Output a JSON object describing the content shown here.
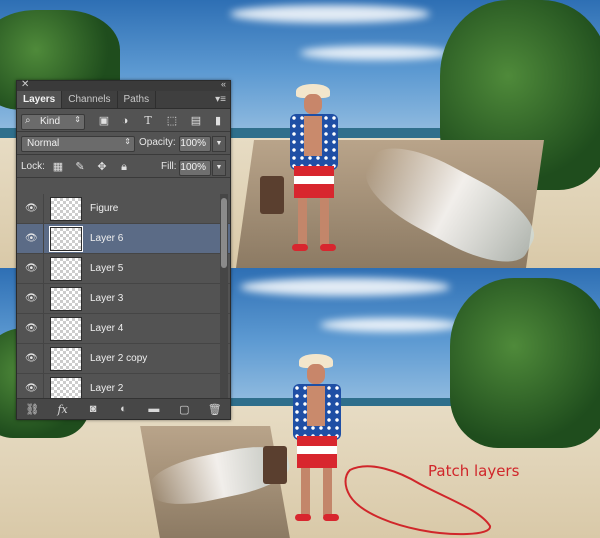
{
  "panel": {
    "close_glyph": "✕",
    "collapse_glyph": "«",
    "tabs": [
      {
        "label": "Layers",
        "active": true
      },
      {
        "label": "Channels",
        "active": false
      },
      {
        "label": "Paths",
        "active": false
      }
    ],
    "menu_glyph": "▾≡",
    "filter": {
      "label": "Kind",
      "icon": "search-icon"
    },
    "filter_icons": [
      "image-filter-icon",
      "adjustment-filter-icon",
      "type-filter-icon",
      "shape-filter-icon",
      "smart-object-filter-icon"
    ],
    "blend_mode": "Normal",
    "opacity_label": "Opacity:",
    "opacity_value": "100%",
    "lock_label": "Lock:",
    "fill_label": "Fill:",
    "fill_value": "100%",
    "layers": [
      {
        "name": "Figure",
        "visible": true,
        "selected": false
      },
      {
        "name": "Layer 6",
        "visible": true,
        "selected": true
      },
      {
        "name": "Layer 5",
        "visible": true,
        "selected": false
      },
      {
        "name": "Layer 3",
        "visible": true,
        "selected": false
      },
      {
        "name": "Layer 4",
        "visible": true,
        "selected": false
      },
      {
        "name": "Layer 2 copy",
        "visible": true,
        "selected": false
      },
      {
        "name": "Layer 2",
        "visible": true,
        "selected": false
      }
    ],
    "bottom_icons": [
      "link-icon",
      "fx-icon",
      "mask-icon",
      "adjustment-icon",
      "folder-icon",
      "new-layer-icon",
      "trash-icon"
    ]
  },
  "annotation": {
    "text": "Patch layers",
    "color": "#d0262a"
  }
}
